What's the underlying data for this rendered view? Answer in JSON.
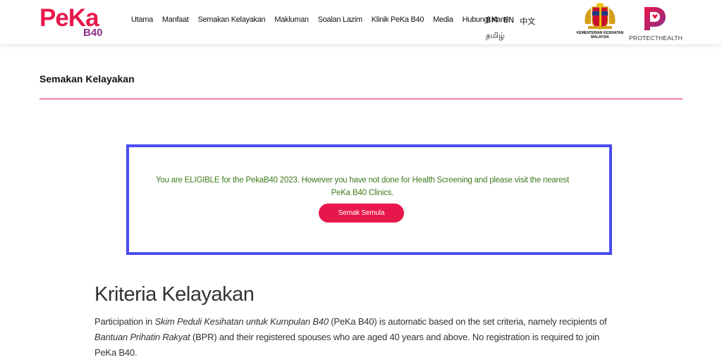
{
  "header": {
    "logo": {
      "text": "PeKa",
      "sub": "B40"
    },
    "nav": [
      {
        "label": "Utama"
      },
      {
        "label": "Manfaat"
      },
      {
        "label": "Semakan Kelayakan"
      },
      {
        "label": "Makluman"
      },
      {
        "label": "Soalan Lazim"
      },
      {
        "label": "Klinik PeKa B40"
      },
      {
        "label": "Media"
      },
      {
        "label": "Hubungi Kami"
      }
    ],
    "languages": {
      "bm": "BM",
      "en": "EN",
      "zh": "中文",
      "ta": "தமிழ்"
    },
    "partners": {
      "kkm_label_line1": "KEMENTERIAN KESIHATAN",
      "kkm_label_line2": "MALAYSIA",
      "protecthealth_label": "PROTECTHEALTH"
    }
  },
  "page": {
    "section_title": "Semakan Kelayakan"
  },
  "result": {
    "message": "You are ELIGIBLE for the PekaB40 2023. However you have not done for Health Screening and please visit the nearest PeKa B40 Clinics.",
    "button_label": "Semak Semula"
  },
  "criteria": {
    "heading": "Kriteria Kelayakan",
    "part1": "Participation in ",
    "italic1": "Skim Peduli Kesihatan untuk Kumpulan B40",
    "part2": " (PeKa B40) is automatic based on the set criteria, namely recipients of ",
    "italic2": "Bantuan Prihatin Rakyat",
    "part3": " (BPR) and their registered spouses who are aged 40 years and above. No registration is required to join PeKa B40."
  },
  "colors": {
    "brand_pink": "#e8174b",
    "brand_purple": "#8a2e88",
    "result_border": "#4a4cf2",
    "eligible_text": "#3e7a1e"
  }
}
